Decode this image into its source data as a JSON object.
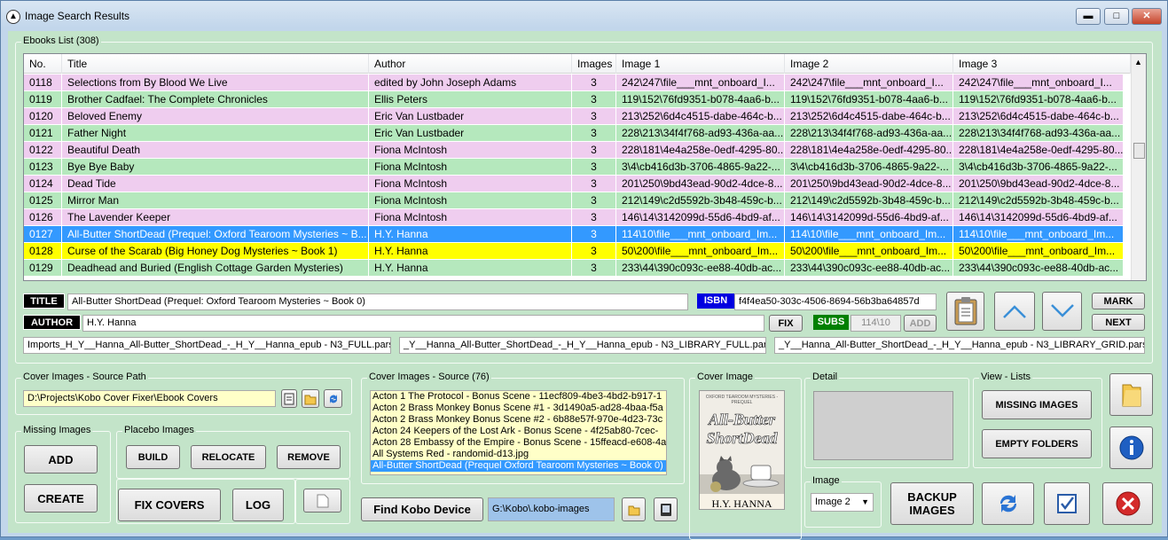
{
  "window": {
    "title": "Image Search Results",
    "min": "▬",
    "max": "□",
    "close": "✕"
  },
  "list": {
    "group_label": "Ebooks List (308)",
    "headers": [
      "No.",
      "Title",
      "Author",
      "Images",
      "Image 1",
      "Image 2",
      "Image 3"
    ],
    "rows": [
      {
        "no": "0118",
        "title": "Selections from By Blood We Live",
        "author": "edited by John Joseph Adams",
        "images": "3",
        "i1": "242\\247\\file___mnt_onboard_I...",
        "i2": "242\\247\\file___mnt_onboard_I...",
        "i3": "242\\247\\file___mnt_onboard_I...",
        "color": "#efcdef"
      },
      {
        "no": "0119",
        "title": "Brother Cadfael: The Complete Chronicles",
        "author": "Ellis Peters",
        "images": "3",
        "i1": "119\\152\\76fd9351-b078-4aa6-b...",
        "i2": "119\\152\\76fd9351-b078-4aa6-b...",
        "i3": "119\\152\\76fd9351-b078-4aa6-b...",
        "color": "#b5e8bd"
      },
      {
        "no": "0120",
        "title": "Beloved Enemy",
        "author": "Eric Van Lustbader",
        "images": "3",
        "i1": "213\\252\\6d4c4515-dabe-464c-b...",
        "i2": "213\\252\\6d4c4515-dabe-464c-b...",
        "i3": "213\\252\\6d4c4515-dabe-464c-b...",
        "color": "#efcdef"
      },
      {
        "no": "0121",
        "title": "Father Night",
        "author": "Eric Van Lustbader",
        "images": "3",
        "i1": "228\\213\\34f4f768-ad93-436a-aa...",
        "i2": "228\\213\\34f4f768-ad93-436a-aa...",
        "i3": "228\\213\\34f4f768-ad93-436a-aa...",
        "color": "#b5e8bd"
      },
      {
        "no": "0122",
        "title": "Beautiful Death",
        "author": "Fiona McIntosh",
        "images": "3",
        "i1": "228\\181\\4e4a258e-0edf-4295-80...",
        "i2": "228\\181\\4e4a258e-0edf-4295-80...",
        "i3": "228\\181\\4e4a258e-0edf-4295-80...",
        "color": "#efcdef"
      },
      {
        "no": "0123",
        "title": "Bye Bye Baby",
        "author": "Fiona McIntosh",
        "images": "3",
        "i1": "3\\4\\cb416d3b-3706-4865-9a22-...",
        "i2": "3\\4\\cb416d3b-3706-4865-9a22-...",
        "i3": "3\\4\\cb416d3b-3706-4865-9a22-...",
        "color": "#b5e8bd"
      },
      {
        "no": "0124",
        "title": "Dead Tide",
        "author": "Fiona McIntosh",
        "images": "3",
        "i1": "201\\250\\9bd43ead-90d2-4dce-8...",
        "i2": "201\\250\\9bd43ead-90d2-4dce-8...",
        "i3": "201\\250\\9bd43ead-90d2-4dce-8...",
        "color": "#efcdef"
      },
      {
        "no": "0125",
        "title": "Mirror Man",
        "author": "Fiona McIntosh",
        "images": "3",
        "i1": "212\\149\\c2d5592b-3b48-459c-b...",
        "i2": "212\\149\\c2d5592b-3b48-459c-b...",
        "i3": "212\\149\\c2d5592b-3b48-459c-b...",
        "color": "#b5e8bd"
      },
      {
        "no": "0126",
        "title": "The Lavender Keeper",
        "author": "Fiona McIntosh",
        "images": "3",
        "i1": "146\\14\\3142099d-55d6-4bd9-af...",
        "i2": "146\\14\\3142099d-55d6-4bd9-af...",
        "i3": "146\\14\\3142099d-55d6-4bd9-af...",
        "color": "#efcdef"
      },
      {
        "no": "0127",
        "title": "All-Butter ShortDead (Prequel: Oxford Tearoom Mysteries ~ B...",
        "author": "H.Y. Hanna",
        "images": "3",
        "i1": "114\\10\\file___mnt_onboard_Im...",
        "i2": "114\\10\\file___mnt_onboard_Im...",
        "i3": "114\\10\\file___mnt_onboard_Im...",
        "color": "#3399ff",
        "fg": "#ffffff"
      },
      {
        "no": "0128",
        "title": "Curse of the Scarab (Big Honey Dog Mysteries ~ Book 1)",
        "author": "H.Y. Hanna",
        "images": "3",
        "i1": "50\\200\\file___mnt_onboard_Im...",
        "i2": "50\\200\\file___mnt_onboard_Im...",
        "i3": "50\\200\\file___mnt_onboard_Im...",
        "color": "#ffff00"
      },
      {
        "no": "0129",
        "title": "Deadhead and Buried (English Cottage Garden Mysteries)",
        "author": "H.Y. Hanna",
        "images": "3",
        "i1": "233\\44\\390c093c-ee88-40db-ac...",
        "i2": "233\\44\\390c093c-ee88-40db-ac...",
        "i3": "233\\44\\390c093c-ee88-40db-ac...",
        "color": "#b5e8bd"
      }
    ]
  },
  "details": {
    "title_label": "TITLE",
    "title_value": "All-Butter ShortDead (Prequel: Oxford Tearoom Mysteries ~ Book 0)",
    "isbn_label": "ISBN",
    "isbn_value": "f4f4ea50-303c-4506-8694-56b3ba64857d",
    "author_label": "AUTHOR",
    "author_value": "H.Y. Hanna",
    "fix": "FIX",
    "subs_label": "SUBS",
    "subs_value": "114\\10",
    "add": "ADD",
    "mark": "MARK",
    "next": "NEXT",
    "parsed1": "Imports_H_Y__Hanna_All-Butter_ShortDead_-_H_Y__Hanna_epub - N3_FULL.parsed",
    "parsed2": "_Y__Hanna_All-Butter_ShortDead_-_H_Y__Hanna_epub - N3_LIBRARY_FULL.parsed",
    "parsed3": "_Y__Hanna_All-Butter_ShortDead_-_H_Y__Hanna_epub - N3_LIBRARY_GRID.parsed"
  },
  "source_path": {
    "label": "Cover Images - Source Path",
    "value": "D:\\Projects\\Kobo Cover Fixer\\Ebook Covers"
  },
  "missing": {
    "label": "Missing Images",
    "add": "ADD",
    "create": "CREATE"
  },
  "placebo": {
    "label": "Placebo Images",
    "build": "BUILD",
    "relocate": "RELOCATE",
    "remove": "REMOVE"
  },
  "fix_covers": "FIX COVERS",
  "log": "LOG",
  "source": {
    "label": "Cover Images - Source (76)",
    "items": [
      "Acton 1 The Protocol - Bonus Scene - 11ecf809-4be3-4bd2-b917-1",
      "Acton 2 Brass Monkey Bonus Scene #1 - 3d1490a5-ad28-4baa-f5a",
      "Acton 2 Brass Monkey Bonus Scene #2 - 6b88e57f-970e-4d23-73c",
      "Acton 24 Keepers of the Lost Ark - Bonus Scene - 4f25ab80-7cec-",
      "Acton 28 Embassy of the Empire - Bonus Scene - 15ffeacd-e608-4a",
      "All Systems Red - randomid-d13.jpg",
      "All-Butter ShortDead (Prequel Oxford Tearoom Mysteries ~ Book 0)"
    ]
  },
  "find_kobo": "Find Kobo Device",
  "kobo_path": "G:\\Kobo\\.kobo-images",
  "cover_image": {
    "label": "Cover Image",
    "top": "OXFORD TEAROOM MYSTERIES - PREQUEL",
    "line1": "All-Butter",
    "line2": "ShortDead",
    "author": "H.Y. HANNA"
  },
  "detail": {
    "label": "Detail"
  },
  "image_select": {
    "label": "Image",
    "value": "Image 2"
  },
  "backup": {
    "line1": "BACKUP",
    "line2": "IMAGES"
  },
  "view_lists": {
    "label": "View - Lists",
    "missing": "MISSING IMAGES",
    "empty": "EMPTY FOLDERS"
  }
}
